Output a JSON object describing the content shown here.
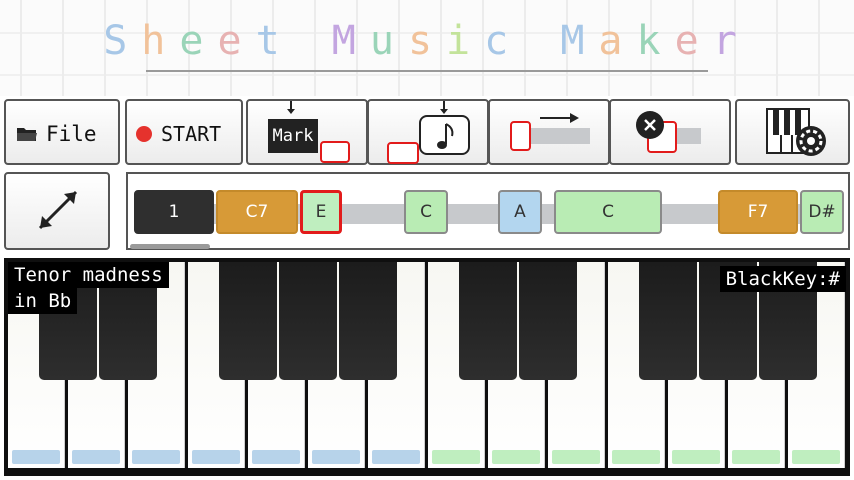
{
  "app": {
    "title_letters": [
      "S",
      "h",
      "e",
      "e",
      "t",
      " ",
      "M",
      "u",
      "s",
      "i",
      "c",
      " ",
      "M",
      "a",
      "k",
      "e",
      "r"
    ],
    "title_colors": [
      "#a7c7e7",
      "#f1c29a",
      "#9ad4b8",
      "#e7b2b2",
      "#a7c7e7",
      "#ffffff",
      "#c3a5e0",
      "#9ad4b8",
      "#f1c29a",
      "#c3e39a",
      "#a7c7e7",
      "#ffffff",
      "#a7c7e7",
      "#f1c29a",
      "#9ad4b8",
      "#e7b2b2",
      "#c3a5e0"
    ]
  },
  "toolbar": {
    "file_label": "File",
    "file_icon": "folder-icon",
    "start_label": "START",
    "start_icon": "record-dot-icon",
    "mark_label": "Mark",
    "note_icon": "eighth-note-icon",
    "move_icon": "right-arrow-icon",
    "delete_icon": "close-circle-icon",
    "settings_icon": "piano-gear-icon",
    "expand_icon": "diagonal-expand-icon"
  },
  "sequence": {
    "chords": [
      {
        "label": "1",
        "bg": "#2f2f2f",
        "fg": "#ffffff",
        "border": "#2f2f2f"
      },
      {
        "label": "C7",
        "bg": "#d79a37",
        "fg": "#ffffff",
        "border": "#c48a2a"
      },
      {
        "label": "E",
        "bg": "#bfeebf",
        "fg": "#333333",
        "border": "#e21b1b"
      },
      {
        "label": "C",
        "bg": "#b9ecb4",
        "fg": "#333333",
        "border": "#8a8a8a"
      },
      {
        "label": "A",
        "bg": "#b3d6ef",
        "fg": "#333333",
        "border": "#8a8a8a"
      },
      {
        "label": "C",
        "bg": "#b9ecb4",
        "fg": "#333333",
        "border": "#8a8a8a"
      },
      {
        "label": "F7",
        "bg": "#d79a37",
        "fg": "#ffffff",
        "border": "#c48a2a"
      },
      {
        "label": "D#",
        "bg": "#b9ecb4",
        "fg": "#333333",
        "border": "#8a8a8a"
      }
    ]
  },
  "piano": {
    "song_title_line1": "Tenor madness",
    "song_title_line2": "in Bb",
    "blackkey_label": "BlackKey:#",
    "white_key_bar_colors": [
      "#b7d3ea",
      "#b7d3ea",
      "#b7d3ea",
      "#b7d3ea",
      "#b7d3ea",
      "#b7d3ea",
      "#b7d3ea",
      "#bfeebf",
      "#bfeebf",
      "#bfeebf",
      "#bfeebf",
      "#bfeebf",
      "#bfeebf",
      "#bfeebf"
    ]
  }
}
